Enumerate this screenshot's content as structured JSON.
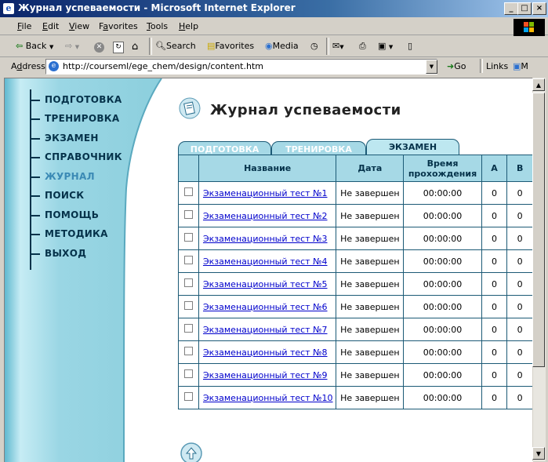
{
  "window": {
    "title": "Журнал успеваемости - Microsoft Internet Explorer",
    "buttons": [
      "_",
      "□",
      "×"
    ]
  },
  "menu": {
    "items": [
      {
        "accel": "F",
        "rest": "ile"
      },
      {
        "accel": "E",
        "rest": "dit"
      },
      {
        "accel": "V",
        "rest": "iew"
      },
      {
        "accel": "",
        "pre": "F",
        "accel2": "a",
        "rest": "vorites"
      },
      {
        "accel": "T",
        "rest": "ools"
      },
      {
        "accel": "H",
        "rest": "elp"
      }
    ]
  },
  "toolbar": {
    "back": "Back",
    "search": "Search",
    "favorites": "Favorites",
    "media": "Media"
  },
  "address": {
    "label_accel": "d",
    "label_pre": "A",
    "label_rest": "dress",
    "url": "http://courseml/ege_chem/design/content.htm",
    "go": "Go",
    "links": "Links",
    "extra": "M"
  },
  "sidebar": {
    "items": [
      {
        "label": "ПОДГОТОВКА",
        "active": false
      },
      {
        "label": "ТРЕНИРОВКА",
        "active": false
      },
      {
        "label": "ЭКЗАМЕН",
        "active": false
      },
      {
        "label": "СПРАВОЧНИК",
        "active": false
      },
      {
        "label": "ЖУРНАЛ",
        "active": true
      },
      {
        "label": "ПОИСК",
        "active": false
      },
      {
        "label": "ПОМОЩЬ",
        "active": false
      },
      {
        "label": "МЕТОДИКА",
        "active": false
      },
      {
        "label": "ВЫХОД",
        "active": false
      }
    ]
  },
  "page": {
    "title": "Журнал успеваемости"
  },
  "tabs": [
    {
      "label": "ПОДГОТОВКА",
      "active": false
    },
    {
      "label": "ТРЕНИРОВКА",
      "active": false
    },
    {
      "label": "ЭКЗАМЕН",
      "active": true
    }
  ],
  "table": {
    "headers": {
      "name": "Название",
      "date": "Дата",
      "time_line1": "Время",
      "time_line2": "прохождения",
      "a": "A",
      "b": "B"
    },
    "rows": [
      {
        "name": "Экзаменационный тест №1",
        "date": "Не завершен",
        "time": "00:00:00",
        "a": "0",
        "b": "0"
      },
      {
        "name": "Экзаменационный тест №2",
        "date": "Не завершен",
        "time": "00:00:00",
        "a": "0",
        "b": "0"
      },
      {
        "name": "Экзаменационный тест №3",
        "date": "Не завершен",
        "time": "00:00:00",
        "a": "0",
        "b": "0"
      },
      {
        "name": "Экзаменационный тест №4",
        "date": "Не завершен",
        "time": "00:00:00",
        "a": "0",
        "b": "0"
      },
      {
        "name": "Экзаменационный тест №5",
        "date": "Не завершен",
        "time": "00:00:00",
        "a": "0",
        "b": "0"
      },
      {
        "name": "Экзаменационный тест №6",
        "date": "Не завершен",
        "time": "00:00:00",
        "a": "0",
        "b": "0"
      },
      {
        "name": "Экзаменационный тест №7",
        "date": "Не завершен",
        "time": "00:00:00",
        "a": "0",
        "b": "0"
      },
      {
        "name": "Экзаменационный тест №8",
        "date": "Не завершен",
        "time": "00:00:00",
        "a": "0",
        "b": "0"
      },
      {
        "name": "Экзаменационный тест №9",
        "date": "Не завершен",
        "time": "00:00:00",
        "a": "0",
        "b": "0"
      },
      {
        "name": "Экзаменационный тест №10",
        "date": "Не завершен",
        "time": "00:00:00",
        "a": "0",
        "b": "0"
      }
    ]
  },
  "colors": {
    "sidebar": "#8fd2e0",
    "accent": "#05324a",
    "active_nav": "#3b8ab5",
    "table_header": "#a6d9e6"
  }
}
